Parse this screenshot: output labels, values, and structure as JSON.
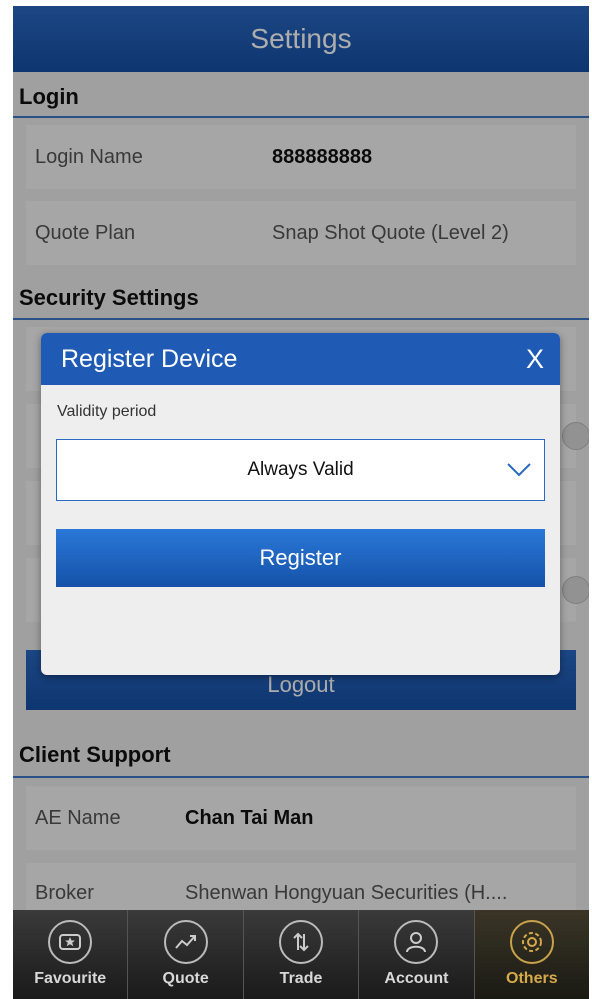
{
  "header": {
    "title": "Settings"
  },
  "login": {
    "section_title": "Login",
    "login_name_label": "Login Name",
    "login_name_value": "888888888",
    "quote_plan_label": "Quote Plan",
    "quote_plan_value": "Snap Shot Quote (Level 2)"
  },
  "security": {
    "section_title": "Security Settings"
  },
  "logout_label": "Logout",
  "client_support": {
    "section_title": "Client Support",
    "ae_name_label": "AE Name",
    "ae_name_value": "Chan Tai Man",
    "broker_label": "Broker",
    "broker_value": "Shenwan Hongyuan Securities (H...."
  },
  "modal": {
    "title": "Register Device",
    "close_label": "X",
    "validity_label": "Validity period",
    "validity_value": "Always Valid",
    "register_label": "Register"
  },
  "tabbar": {
    "items": [
      {
        "label": "Favourite",
        "icon": "favourite-icon"
      },
      {
        "label": "Quote",
        "icon": "quote-icon"
      },
      {
        "label": "Trade",
        "icon": "trade-icon"
      },
      {
        "label": "Account",
        "icon": "account-icon"
      },
      {
        "label": "Others",
        "icon": "others-icon",
        "active": true
      }
    ]
  },
  "colors": {
    "primary": "#1f5bb5",
    "active_tab": "#d6a94a"
  }
}
